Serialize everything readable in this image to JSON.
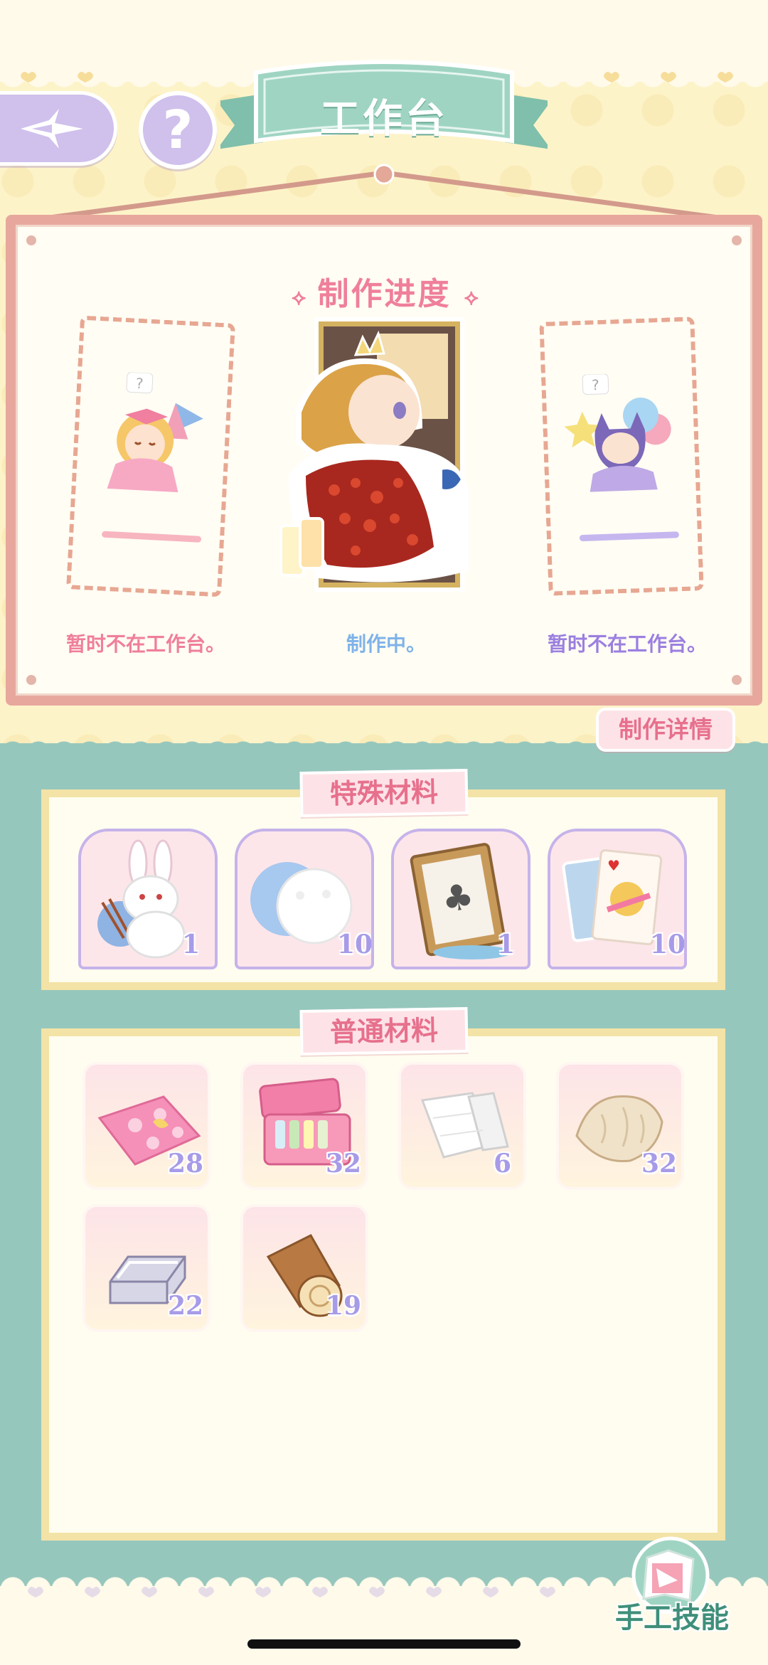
{
  "header": {
    "title": "工作台",
    "help_label": "?"
  },
  "progress": {
    "title": "制作进度",
    "slots": [
      {
        "status": "暂时不在工作台。",
        "status_color": "#ef7f9a"
      },
      {
        "status": "制作中。",
        "status_color": "#7fb3e8"
      },
      {
        "status": "暂时不在工作台。",
        "status_color": "#9b7fe0"
      }
    ],
    "details_label": "制作详情"
  },
  "special_materials": {
    "title": "特殊材料",
    "items": [
      {
        "icon": "bunny-plush-icon",
        "count": "1"
      },
      {
        "icon": "cotton-ball-icon",
        "count": "10"
      },
      {
        "icon": "card-frame-icon",
        "count": "1"
      },
      {
        "icon": "playing-cards-icon",
        "count": "10"
      }
    ]
  },
  "common_materials": {
    "title": "普通材料",
    "items": [
      {
        "icon": "polka-dot-fabric-icon",
        "count": "28"
      },
      {
        "icon": "sewing-box-icon",
        "count": "32"
      },
      {
        "icon": "white-cloth-icon",
        "count": "6"
      },
      {
        "icon": "fur-pelt-icon",
        "count": "32"
      },
      {
        "icon": "silver-ingot-icon",
        "count": "22"
      },
      {
        "icon": "wood-log-icon",
        "count": "19"
      }
    ]
  },
  "footer": {
    "skill_label": "手工技能"
  },
  "colors": {
    "teal": "#96c7bd",
    "cream": "#fdf3c9",
    "pink_accent": "#e7708d",
    "lavender": "#cfc0ec"
  }
}
